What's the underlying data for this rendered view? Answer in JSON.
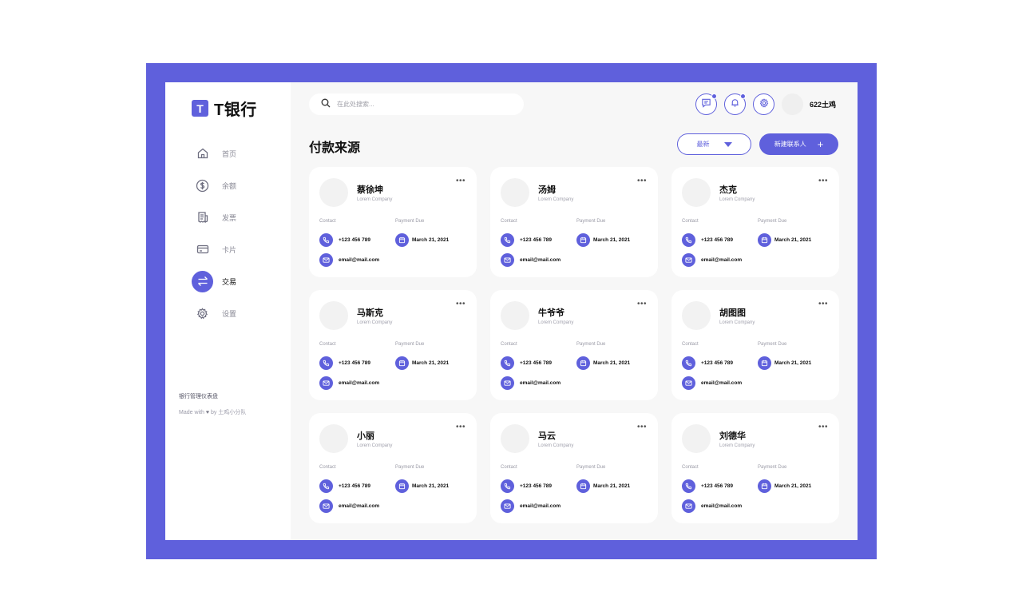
{
  "app": {
    "logo_letter": "T",
    "logo_text": "T银行"
  },
  "sidebar": {
    "items": [
      {
        "label": "首页",
        "icon": "home-icon",
        "active": false
      },
      {
        "label": "余额",
        "icon": "dollar-icon",
        "active": false
      },
      {
        "label": "发票",
        "icon": "invoice-icon",
        "active": false
      },
      {
        "label": "卡片",
        "icon": "card-icon",
        "active": false
      },
      {
        "label": "交易",
        "icon": "transfer-icon",
        "active": true
      },
      {
        "label": "设置",
        "icon": "gear-icon",
        "active": false
      }
    ],
    "footer_title": "银行管理仪表盘",
    "footer_made_prefix": "Made with",
    "footer_made_suffix": "by 土鸡小分队"
  },
  "header": {
    "search_placeholder": "在此处搜索...",
    "user_name": "622土鸡"
  },
  "main": {
    "title": "付款来源",
    "sort_label": "最新",
    "new_button_label": "新建联系人",
    "contact_label": "Contact",
    "due_label": "Payment Due",
    "cards": [
      {
        "name": "蔡徐坤",
        "company": "Lorem Company",
        "phone": "+123 456 789",
        "due": "March 21, 2021",
        "email": "email@mail.com"
      },
      {
        "name": "汤姆",
        "company": "Lorem Company",
        "phone": "+123 456 789",
        "due": "March 21, 2021",
        "email": "email@mail.com"
      },
      {
        "name": "杰克",
        "company": "Lorem Company",
        "phone": "+123 456 789",
        "due": "March 21, 2021",
        "email": "email@mail.com"
      },
      {
        "name": "马斯克",
        "company": "Lorem Company",
        "phone": "+123 456 789",
        "due": "March 21, 2021",
        "email": "email@mail.com"
      },
      {
        "name": "牛爷爷",
        "company": "Lorem Company",
        "phone": "+123 456 789",
        "due": "March 21, 2021",
        "email": "email@mail.com"
      },
      {
        "name": "胡图图",
        "company": "Lorem Company",
        "phone": "+123 456 789",
        "due": "March 21, 2021",
        "email": "email@mail.com"
      },
      {
        "name": "小丽",
        "company": "Lorem Company",
        "phone": "+123 456 789",
        "due": "March 21, 2021",
        "email": "email@mail.com"
      },
      {
        "name": "马云",
        "company": "Lorem Company",
        "phone": "+123 456 789",
        "due": "March 21, 2021",
        "email": "email@mail.com"
      },
      {
        "name": "刘德华",
        "company": "Lorem Company",
        "phone": "+123 456 789",
        "due": "March 21, 2021",
        "email": "email@mail.com"
      }
    ]
  },
  "colors": {
    "accent": "#5f60dc",
    "background": "#f7f7f7",
    "card": "#ffffff"
  }
}
